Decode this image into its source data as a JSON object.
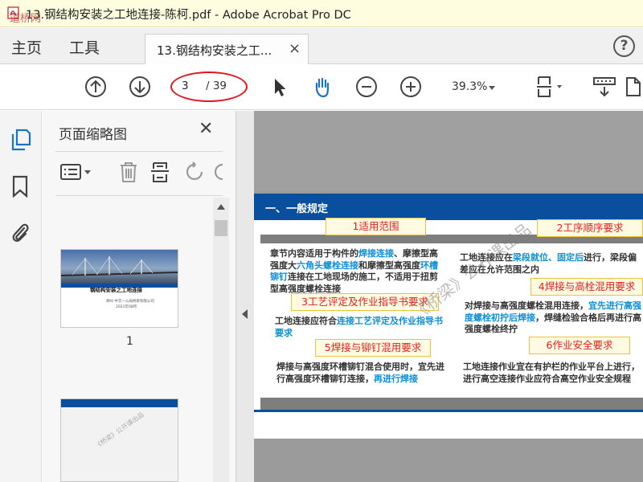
{
  "window": {
    "title": "13.钢结构安装之工地连接-陈柯.pdf - Adobe Acrobat Pro DC",
    "watermark": "道桥网"
  },
  "tabs": {
    "home": "主页",
    "tools": "工具",
    "document": "13.钢结构安装之工...",
    "close_glyph": "×",
    "help_glyph": "?"
  },
  "toolbar": {
    "current_page": "3",
    "total_pages": "/ 39",
    "zoom": "39.3%"
  },
  "panel": {
    "title": "页面缩略图",
    "close_glyph": "✕",
    "thumb1_label": "1",
    "thumb1_title": "钢结构安装之工地连接",
    "thumb1_org": "郑州 中交一公局桥梁有限公司",
    "thumb1_date": "2021年08月",
    "thumb_watermark": "《桥梁》公开课出品"
  },
  "page": {
    "heading": "一、一般规定",
    "callouts": {
      "c1": "1适用范围",
      "c2": "2工序顺序要求",
      "c3": "3工艺评定及作业指导书要求",
      "c4": "4焊接与高栓混用要求",
      "c5": "5焊接与铆钉混用要求",
      "c6": "6作业安全要求"
    },
    "p1": {
      "a": "章节内容适用于构件的",
      "b": "焊接连接",
      "c": "、摩擦型高强度大",
      "d": "六角头螺栓连接",
      "e": "和摩擦型高强度",
      "f": "环槽铆钉",
      "g": "连接在工地现场的施工，不适用于扭剪型高强度螺栓连接"
    },
    "p2": {
      "a": "工地连接应在",
      "b": "梁段就位、固定后",
      "c": "进行，梁段偏差应在允许范围之内"
    },
    "p3": {
      "a": "工地连接应符合",
      "b": "连接工艺评定及作业指导书要求"
    },
    "p4": {
      "a": "对焊接与高强度螺栓混用连接，",
      "b": "宜先进行高强度螺栓初拧后焊接",
      "c": "，焊缝检验合格后再进行高强度螺栓终拧"
    },
    "p5": {
      "a": "焊接与高强度环槽铆钉混合使用时，宜先进行高强度环槽铆钉连接，",
      "b": "再进行焊接"
    },
    "p6": "工地连接作业宜在有护栏的作业平台上进行，进行高空连接作业应符合高空作业安全规程",
    "watermark": "《桥梁》公开课出品"
  },
  "colors": {
    "accent_blue": "#0a4f9d",
    "highlight": "#0c8fd6",
    "callout_red": "#e0201f",
    "annotation_red": "#e0141a"
  }
}
